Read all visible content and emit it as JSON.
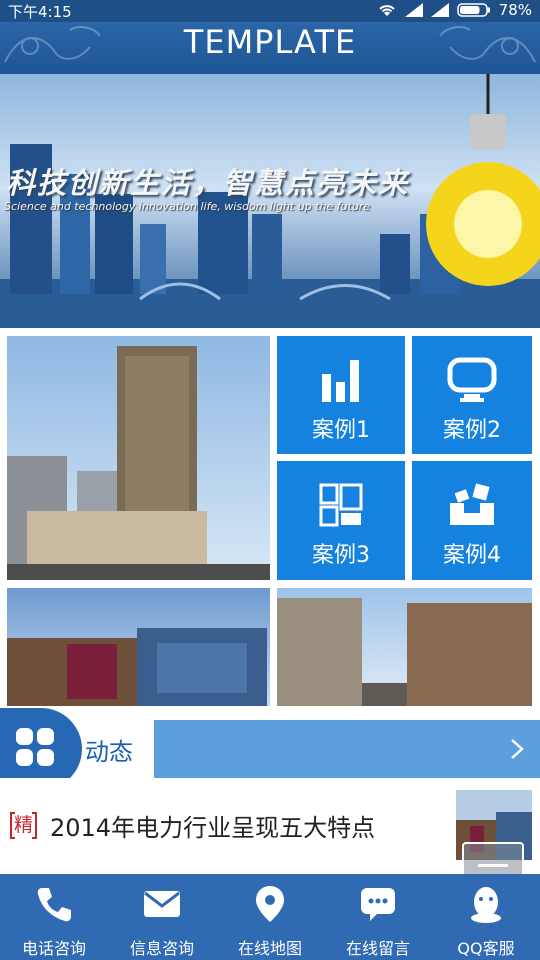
{
  "status_bar": {
    "time": "下午4:15",
    "battery": "78%",
    "battery_level": 0.78,
    "icons": [
      "wifi-icon",
      "signal-icon",
      "signal-icon",
      "battery-icon"
    ]
  },
  "header": {
    "title": "TEMPLATE"
  },
  "banner": {
    "headline": "科技创新生活，智慧点亮未来",
    "subline": "Science and technology innovation life, wisdom light up the future"
  },
  "cases": [
    {
      "label": "案例1",
      "icon": "bar-chart-icon"
    },
    {
      "label": "案例2",
      "icon": "monitor-icon"
    },
    {
      "label": "案例3",
      "icon": "layout-grid-icon"
    },
    {
      "label": "案例4",
      "icon": "box-icon"
    }
  ],
  "news_section": {
    "label": "动态",
    "icon": "apps-grid-icon",
    "more_icon": "chevron-right-icon"
  },
  "news_items": [
    {
      "tag": "精",
      "title": "2014年电力行业呈现五大特点"
    }
  ],
  "bottom_nav": [
    {
      "label": "电话咨询",
      "icon": "phone-icon"
    },
    {
      "label": "信息咨询",
      "icon": "mail-icon"
    },
    {
      "label": "在线地图",
      "icon": "map-pin-icon"
    },
    {
      "label": "在线留言",
      "icon": "chat-icon"
    },
    {
      "label": "QQ客服",
      "icon": "qq-icon"
    }
  ],
  "colors": {
    "status_bar": "#1e4f86",
    "header": "#2a66a8",
    "tile": "#1682e0",
    "news_bar": "#5d9fdc",
    "bottom_nav": "#2f6ab2",
    "tag": "#c8262d"
  }
}
